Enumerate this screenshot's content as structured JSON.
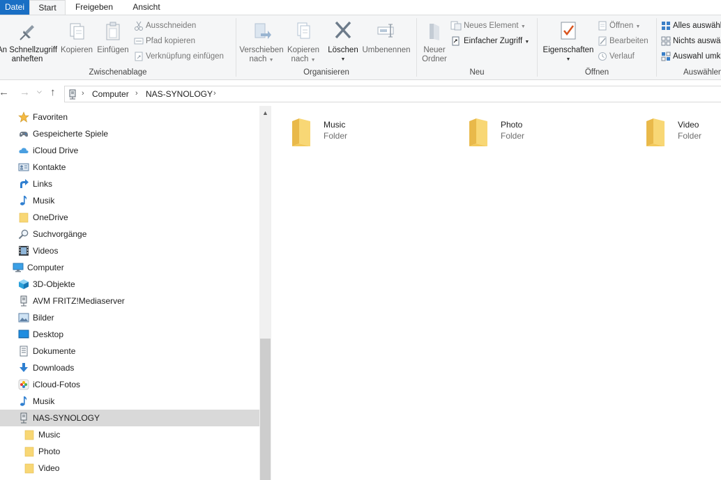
{
  "tabs": {
    "file": "Datei",
    "start": "Start",
    "share": "Freigeben",
    "view": "Ansicht"
  },
  "ribbon": {
    "clipboard": {
      "label": "Zwischenablage",
      "pin_line1": "An Schnellzugriff",
      "pin_line2": "anheften",
      "copy": "Kopieren",
      "paste": "Einfügen",
      "cut": "Ausschneiden",
      "copy_path": "Pfad kopieren",
      "paste_shortcut": "Verknüpfung einfügen"
    },
    "organize": {
      "label": "Organisieren",
      "move_line1": "Verschieben",
      "move_line2": "nach",
      "copyto_line1": "Kopieren",
      "copyto_line2": "nach",
      "delete": "Löschen",
      "rename": "Umbenennen"
    },
    "new": {
      "label": "Neu",
      "folder_line1": "Neuer",
      "folder_line2": "Ordner",
      "new_item": "Neues Element",
      "easy_access": "Einfacher Zugriff"
    },
    "open": {
      "label": "Öffnen",
      "properties": "Eigenschaften",
      "open": "Öffnen",
      "edit": "Bearbeiten",
      "history": "Verlauf"
    },
    "select": {
      "label": "Auswählen",
      "select_all": "Alles auswählen",
      "select_none": "Nichts auswählen",
      "invert": "Auswahl umkehren"
    }
  },
  "address": {
    "crumbs": [
      "Computer",
      "NAS-SYNOLOGY"
    ]
  },
  "tree": {
    "items": [
      {
        "label": "Favoriten",
        "icon": "star-icon"
      },
      {
        "label": "Gespeicherte Spiele",
        "icon": "saved-games-icon"
      },
      {
        "label": "iCloud Drive",
        "icon": "icloud-icon"
      },
      {
        "label": "Kontakte",
        "icon": "contacts-icon"
      },
      {
        "label": "Links",
        "icon": "links-icon"
      },
      {
        "label": "Musik",
        "icon": "music-icon"
      },
      {
        "label": "OneDrive",
        "icon": "folder-icon"
      },
      {
        "label": "Suchvorgänge",
        "icon": "search-icon"
      },
      {
        "label": "Videos",
        "icon": "video-icon"
      },
      {
        "label": "Computer",
        "icon": "computer-icon"
      },
      {
        "label": "3D-Objekte",
        "icon": "3d-objects-icon"
      },
      {
        "label": "AVM FRITZ!Mediaserver",
        "icon": "network-drive-icon"
      },
      {
        "label": "Bilder",
        "icon": "pictures-icon"
      },
      {
        "label": "Desktop",
        "icon": "desktop-icon"
      },
      {
        "label": "Dokumente",
        "icon": "documents-icon"
      },
      {
        "label": "Downloads",
        "icon": "downloads-icon"
      },
      {
        "label": "iCloud-Fotos",
        "icon": "icloud-photos-icon"
      },
      {
        "label": "Musik",
        "icon": "music-icon"
      },
      {
        "label": "NAS-SYNOLOGY",
        "icon": "network-drive-icon"
      },
      {
        "label": "Music",
        "icon": "folder-icon"
      },
      {
        "label": "Photo",
        "icon": "folder-icon"
      },
      {
        "label": "Video",
        "icon": "folder-icon"
      }
    ]
  },
  "content": {
    "folders": [
      {
        "name": "Music",
        "type": "Folder"
      },
      {
        "name": "Photo",
        "type": "Folder"
      },
      {
        "name": "Video",
        "type": "Folder"
      }
    ]
  },
  "colors": {
    "file_tab": "#1a6fc4",
    "ribbon_bg": "#f5f6f7",
    "selection": "#d9d9d9",
    "folder_yellow": "#f8d775"
  }
}
